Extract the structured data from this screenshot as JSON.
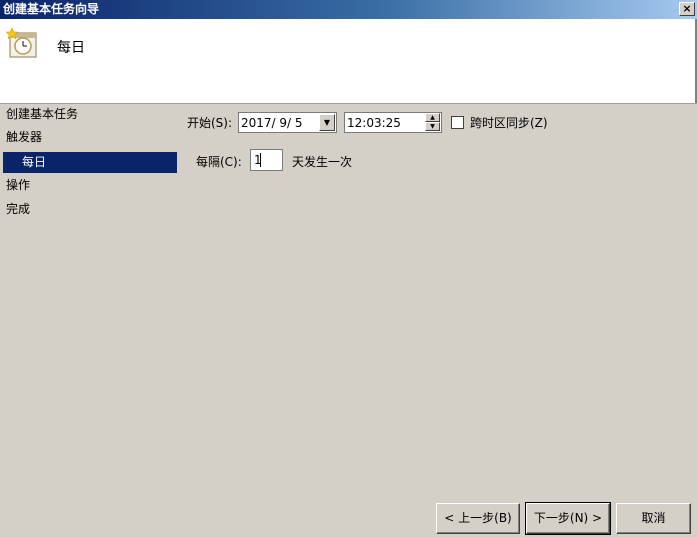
{
  "window": {
    "title": "创建基本任务向导",
    "close_glyph": "×"
  },
  "header": {
    "title": "每日",
    "icon": "clock-calendar-icon"
  },
  "nav": {
    "items": [
      {
        "label": "创建基本任务"
      },
      {
        "label": "触发器"
      },
      {
        "label": "每日",
        "selected": true
      },
      {
        "label": "操作"
      },
      {
        "label": "完成"
      }
    ]
  },
  "form": {
    "start_label": "开始(S):",
    "start_date": "2017/  9/  5",
    "start_time": "12:03:25",
    "sync_timezone_label": "跨时区同步(Z)",
    "sync_timezone_checked": false,
    "recur_label": "每隔(C):",
    "recur_value": "1",
    "recur_suffix": "天发生一次"
  },
  "buttons": {
    "back": "< 上一步(B)",
    "next": "下一步(N) >",
    "cancel": "取消"
  }
}
